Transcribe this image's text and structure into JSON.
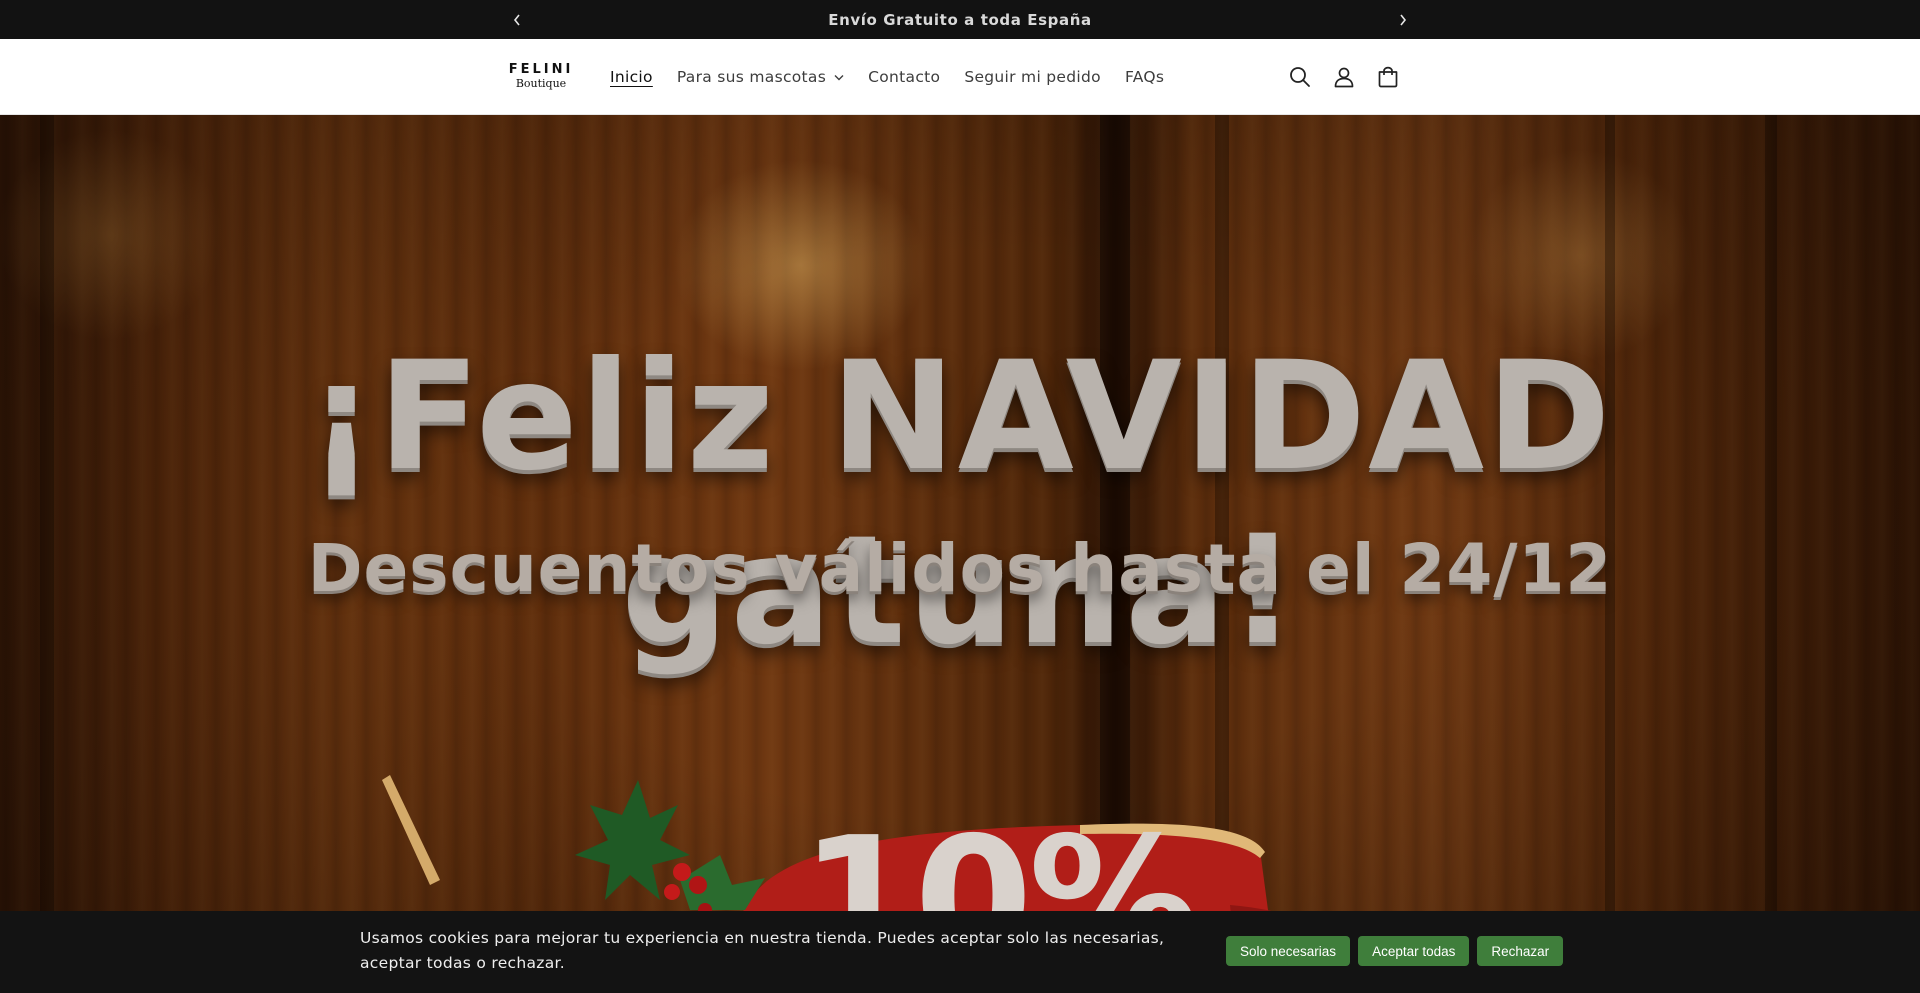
{
  "announcement": {
    "text": "Envío Gratuito a toda España",
    "prev_icon": "chevron-left-icon",
    "next_icon": "chevron-right-icon"
  },
  "header": {
    "logo": {
      "main": "FELINI",
      "sub": "Boutique"
    },
    "nav": [
      {
        "label": "Inicio",
        "active": true
      },
      {
        "label": "Para sus mascotas",
        "has_dropdown": true
      },
      {
        "label": "Contacto"
      },
      {
        "label": "Seguir mi pedido"
      },
      {
        "label": "FAQs"
      }
    ],
    "icons": [
      "search-icon",
      "account-icon",
      "cart-icon"
    ]
  },
  "hero": {
    "title": "¡Feliz NAVIDAD gatuna!",
    "subtitle": "Descuentos válidos hasta el 24/12",
    "badge_partial": "10%"
  },
  "cookie_banner": {
    "text": "Usamos cookies para mejorar tu experiencia en nuestra tienda. Puedes aceptar solo las necesarias, aceptar todas o rechazar.",
    "buttons": {
      "necessary": "Solo necesarias",
      "accept_all": "Aceptar todas",
      "reject": "Rechazar"
    },
    "button_color": "#3f7e3b"
  }
}
